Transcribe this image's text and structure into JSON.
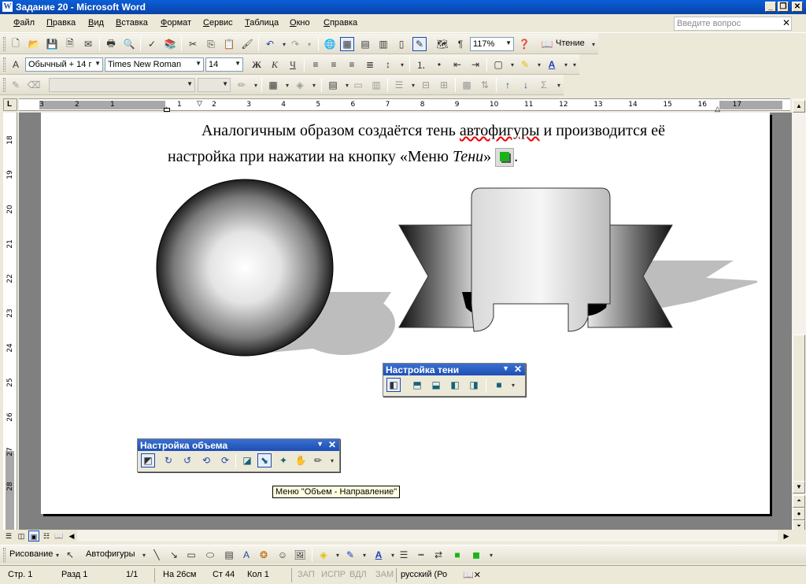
{
  "title": "Задание 20 - Microsoft Word",
  "menu": [
    "Файл",
    "Правка",
    "Вид",
    "Вставка",
    "Формат",
    "Сервис",
    "Таблица",
    "Окно",
    "Справка"
  ],
  "ask_placeholder": "Введите вопрос",
  "standard_toolbar": {
    "zoom": "117%",
    "reading_label": "Чтение"
  },
  "formatting_toolbar": {
    "style": "Обычный + 14 г",
    "font": "Times New Roman",
    "size": "14",
    "bold": "Ж",
    "italic": "К",
    "underline": "Ч"
  },
  "ruler": {
    "left": [
      "3",
      "2",
      "1"
    ],
    "right": [
      "1",
      "2",
      "3",
      "4",
      "5",
      "6",
      "7",
      "8",
      "9",
      "10",
      "11",
      "12",
      "13",
      "14",
      "15",
      "16",
      "17"
    ],
    "vertical": [
      "18",
      "19",
      "20",
      "21",
      "22",
      "23",
      "24",
      "25",
      "26",
      "27",
      "28"
    ]
  },
  "document": {
    "line1_a": "Аналогичным образом создаётся тень ",
    "line1_word": "автофигуры",
    "line1_b": " и производится её",
    "line2_a": "настройка при нажатии на кнопку «Меню ",
    "line2_italic": "Тени",
    "line2_b": "»",
    "line2_end": "."
  },
  "shadow_toolbar": {
    "title": "Настройка тени"
  },
  "volume_toolbar": {
    "title": "Настройка объема"
  },
  "tooltip": "Меню \"Объем - Направление\"",
  "drawing_toolbar": {
    "draw_label": "Рисование",
    "autoshapes_label": "Автофигуры"
  },
  "status": {
    "page": "Стр. 1",
    "section": "Разд 1",
    "pages": "1/1",
    "at": "На 26см",
    "line": "Ст 44",
    "col": "Кол 1",
    "rec": "ЗАП",
    "trk": "ИСПР",
    "ext": "ВДЛ",
    "ovr": "ЗАМ",
    "lang": "русский (Ро"
  },
  "colors": {
    "title_bar": "#0842a8",
    "misspell_underline": "#e00000",
    "shadow_button_green": "#18b418"
  }
}
